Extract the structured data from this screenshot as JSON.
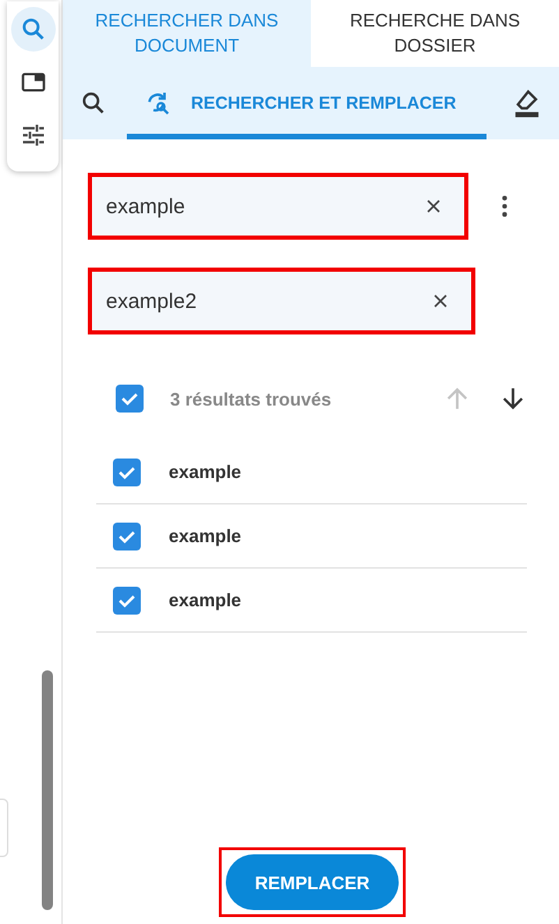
{
  "rail": {
    "items": [
      {
        "kind": "search",
        "selected": true
      },
      {
        "kind": "panel",
        "selected": false
      },
      {
        "kind": "sliders",
        "selected": false
      }
    ]
  },
  "tabs": [
    {
      "label": "RECHERCHER DANS DOCUMENT",
      "selected": true
    },
    {
      "label": "RECHERCHE DANS DOSSIER",
      "selected": false
    }
  ],
  "modes": [
    {
      "kind": "search",
      "selected": false
    },
    {
      "kind": "replace",
      "label": "RECHERCHER ET REMPLACER",
      "selected": true
    }
  ],
  "find_field": {
    "value": "example",
    "highlighted": true
  },
  "replace_field": {
    "value": "example2",
    "highlighted": true
  },
  "results": {
    "checked": true,
    "summary": "3 résultats trouvés",
    "previous_disabled": true
  },
  "matches": [
    {
      "text": "example",
      "checked": true
    },
    {
      "text": "example",
      "checked": true
    },
    {
      "text": "example",
      "checked": true
    }
  ],
  "replace_button": {
    "label": "REMPLACER",
    "highlighted": true
  }
}
